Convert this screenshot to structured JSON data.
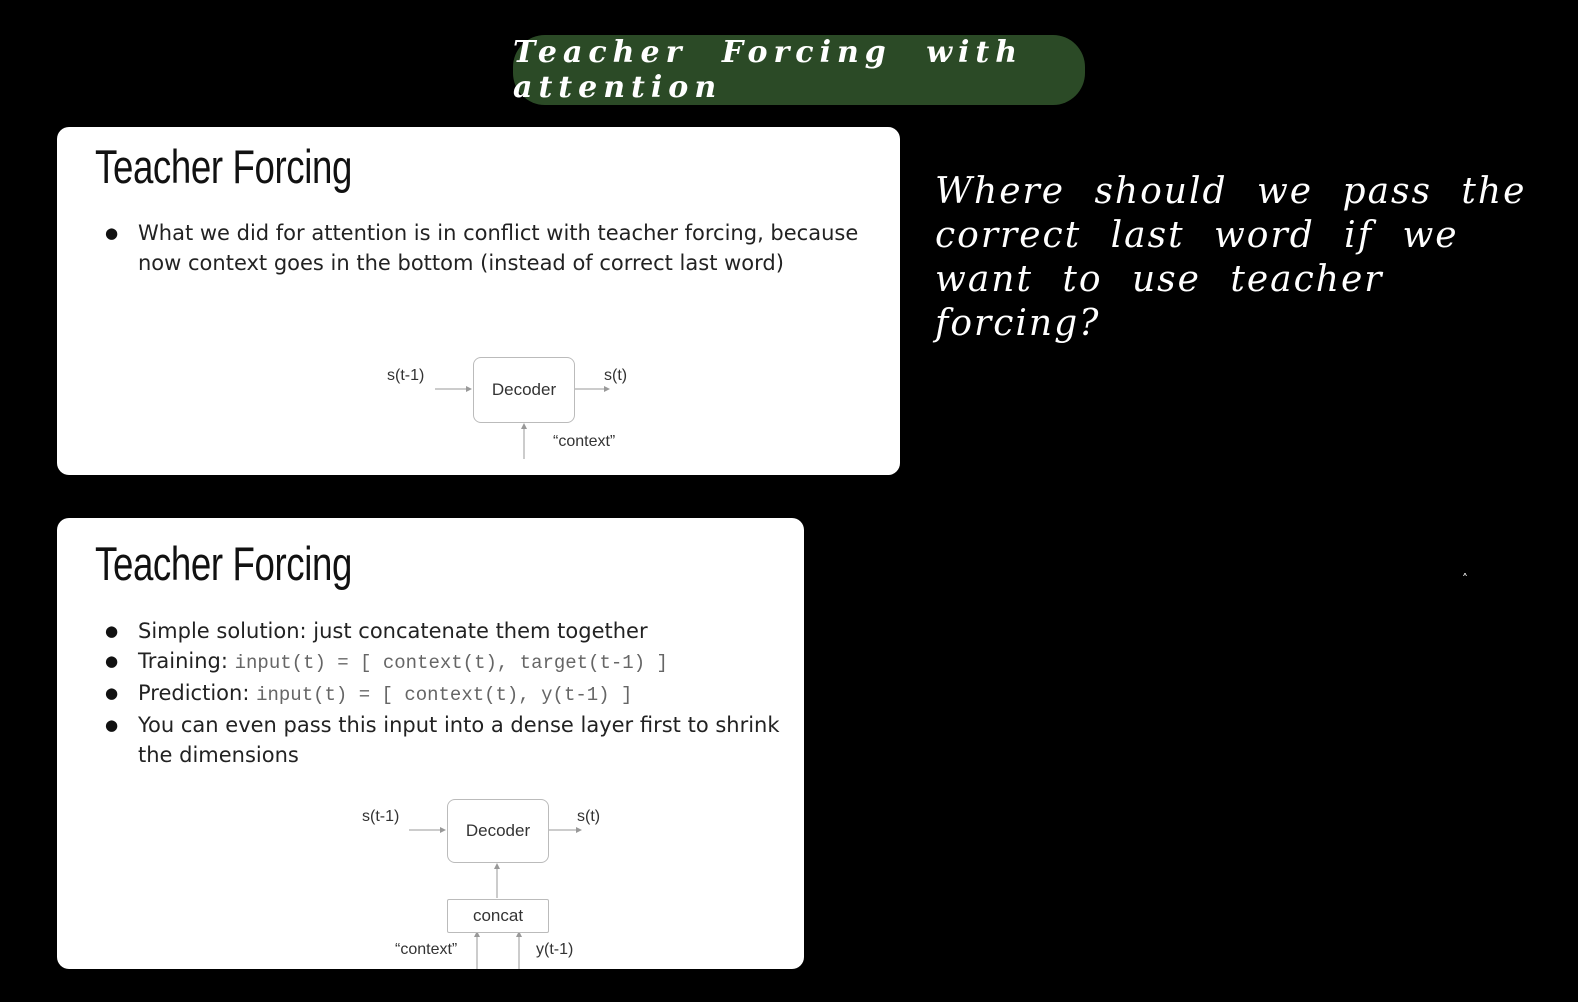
{
  "header": {
    "handwritten_title": "Teacher Forcing with attention"
  },
  "note": {
    "handwritten_question": "Where should we pass the correct last word if we want to use teacher forcing?"
  },
  "slide1": {
    "title": "Teacher Forcing",
    "bullets": [
      "What we did for attention is in conflict with teacher forcing, because now context goes in the bottom (instead of correct last word)"
    ],
    "diagram": {
      "input_label": "s(t-1)",
      "box_label": "Decoder",
      "output_label": "s(t)",
      "bottom_label": "“context”"
    }
  },
  "slide2": {
    "title": "Teacher Forcing",
    "bullet1": "Simple solution: just concatenate them together",
    "bullet2_label": "Training:",
    "bullet2_code": "input(t) = [ context(t), target(t-1) ]",
    "bullet3_label": "Prediction:",
    "bullet3_code": "input(t) = [ context(t), y(t-1) ]",
    "bullet4": "You can even pass this input into a dense layer first to shrink the dimensions",
    "diagram": {
      "input_label": "s(t-1)",
      "box_label": "Decoder",
      "output_label": "s(t)",
      "concat_label": "concat",
      "context_label": "“context”",
      "y_label": "y(t-1)"
    }
  }
}
